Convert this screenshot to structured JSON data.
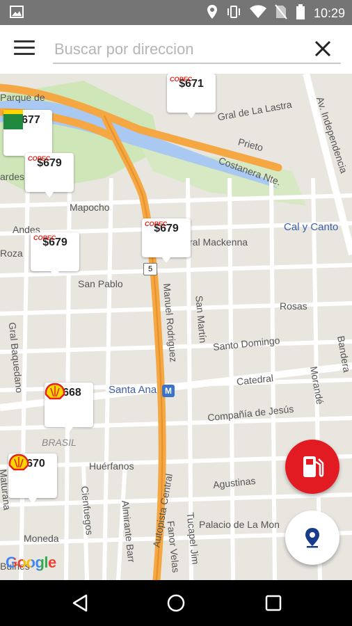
{
  "status_bar": {
    "time": "10:29",
    "icons": [
      "image-icon",
      "location-icon",
      "vibrate-icon",
      "wifi-icon",
      "no-sim-icon",
      "battery-icon"
    ]
  },
  "search": {
    "placeholder": "Buscar por direccion",
    "value": ""
  },
  "map": {
    "street_labels": [
      "Parque de",
      "Gral de La Lastra",
      "Prieto",
      "Av. Independencia",
      "Costanera Nte.",
      "ardes",
      "Mapocho",
      "Andes",
      "Cal y Canto",
      "ral Mackenna",
      "Roza",
      "San Pablo",
      "Rosas",
      "Manuel Rodriguez",
      "San Martín",
      "Santo Domingo",
      "Bandera",
      "Gral Baquedano",
      "Catedral",
      "Morandé",
      "Santa Ana",
      "Compañía de Jesús",
      "BRASIL",
      "Huérfanos",
      "Agustinas",
      "Maturana",
      "Cienfuegos",
      "Almirante Barr",
      "Autopista Central",
      "Tucapel Jim",
      "Palacio de La Mon",
      "Moneda",
      "Fanor Velas",
      "Bulnes"
    ],
    "metro_badge": "M",
    "route_shield": "5",
    "attribution": "Google"
  },
  "stations": [
    {
      "price": "$671",
      "brand": "Copec"
    },
    {
      "price": "$677",
      "brand": "BP"
    },
    {
      "price": "$679",
      "brand": "Copec"
    },
    {
      "price": "$679",
      "brand": "Copec"
    },
    {
      "price": "$679",
      "brand": "Copec"
    },
    {
      "price": "$668",
      "brand": "Shell"
    },
    {
      "price": "$670",
      "brand": "Shell"
    }
  ],
  "actions": {
    "fuel_fab_icon": "gas-pump-icon",
    "location_fab_icon": "location-pin-icon"
  },
  "colors": {
    "fuel_fab": "#e21b23",
    "highway": "#f4a742",
    "copec_red": "#e2231a",
    "shell_yellow": "#ffd500",
    "bp_green": "#009b3a",
    "location_pin": "#1a3b8c"
  }
}
